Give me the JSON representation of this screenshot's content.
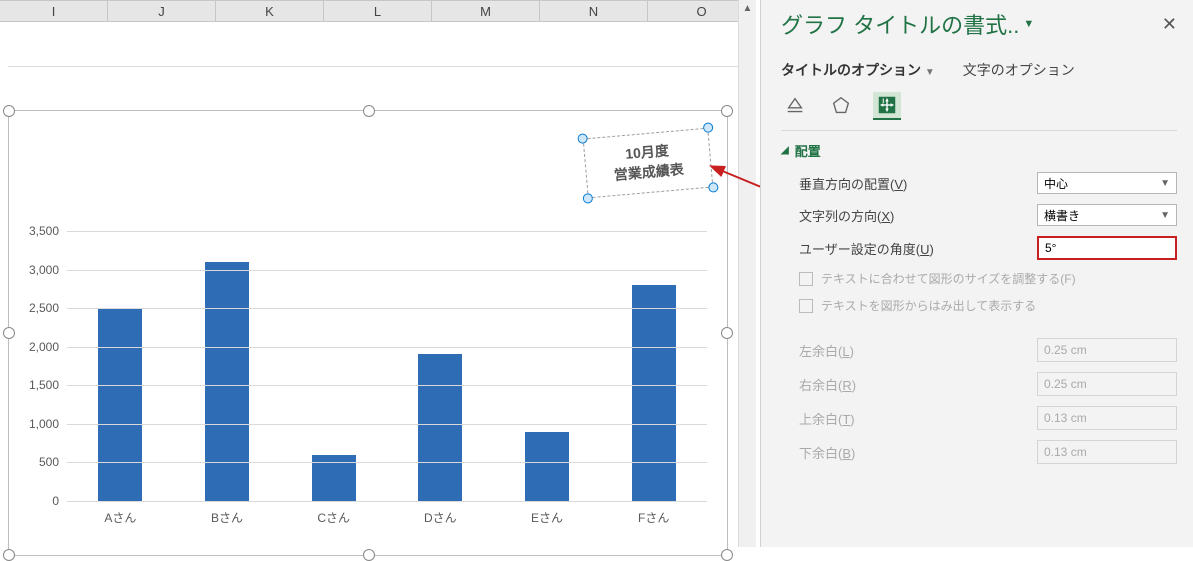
{
  "columns": [
    "I",
    "J",
    "K",
    "L",
    "M",
    "N",
    "O"
  ],
  "chart_data": {
    "type": "bar",
    "categories": [
      "Aさん",
      "Bさん",
      "Cさん",
      "Dさん",
      "Eさん",
      "Fさん"
    ],
    "values": [
      2500,
      3100,
      600,
      1900,
      900,
      2800
    ],
    "yticks": [
      0,
      500,
      1000,
      1500,
      2000,
      2500,
      3000,
      3500
    ],
    "ylim": [
      0,
      3500
    ],
    "title_line1": "10月度",
    "title_line2": "営業成績表"
  },
  "panel": {
    "title": "グラフ タイトルの書式..",
    "tab_title_options": "タイトルのオプション",
    "tab_text_options": "文字のオプション",
    "section_alignment": "配置",
    "label_vertical_align": "垂直方向の配置(",
    "key_v": "V",
    "val_vertical_align": "中心",
    "label_text_direction": "文字列の方向(",
    "key_x": "X",
    "val_text_direction": "横書き",
    "label_custom_angle": "ユーザー設定の角度(",
    "key_u": "U",
    "val_custom_angle": "5°",
    "chk_resize": "テキストに合わせて図形のサイズを調整する(",
    "key_f": "F",
    "chk_overflow": "テキストを図形からはみ出して表示する",
    "label_margin_left": "左余白(",
    "key_l": "L",
    "val_margin_left": "0.25 cm",
    "label_margin_right": "右余白(",
    "key_r": "R",
    "val_margin_right": "0.25 cm",
    "label_margin_top": "上余白(",
    "key_t": "T",
    "val_margin_top": "0.13 cm",
    "label_margin_bottom": "下余白(",
    "key_b": "B",
    "val_margin_bottom": "0.13 cm"
  }
}
